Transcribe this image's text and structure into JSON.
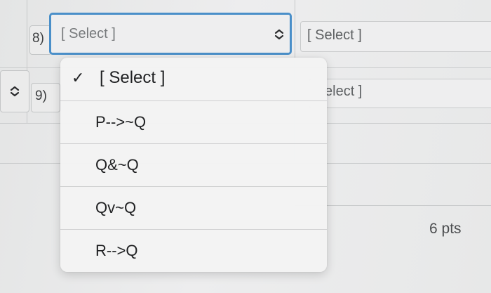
{
  "rows": [
    {
      "number": "8)",
      "main_select": {
        "value": "[ Select ]",
        "icon": "chevron-updown-icon"
      },
      "right_select": {
        "value": "[ Select ]"
      }
    },
    {
      "number": "9)",
      "right_select": {
        "value": "elect ]"
      }
    }
  ],
  "points": "6 pts",
  "dropdown": {
    "selected_index": 0,
    "check_glyph": "✓",
    "options": [
      {
        "label": "[ Select ]"
      },
      {
        "label": "P-->~Q"
      },
      {
        "label": "Q&~Q"
      },
      {
        "label": "Qv~Q"
      },
      {
        "label": "R-->Q"
      }
    ]
  },
  "colors": {
    "focus_border": "#4a8fc9",
    "background": "#e9eaea"
  }
}
